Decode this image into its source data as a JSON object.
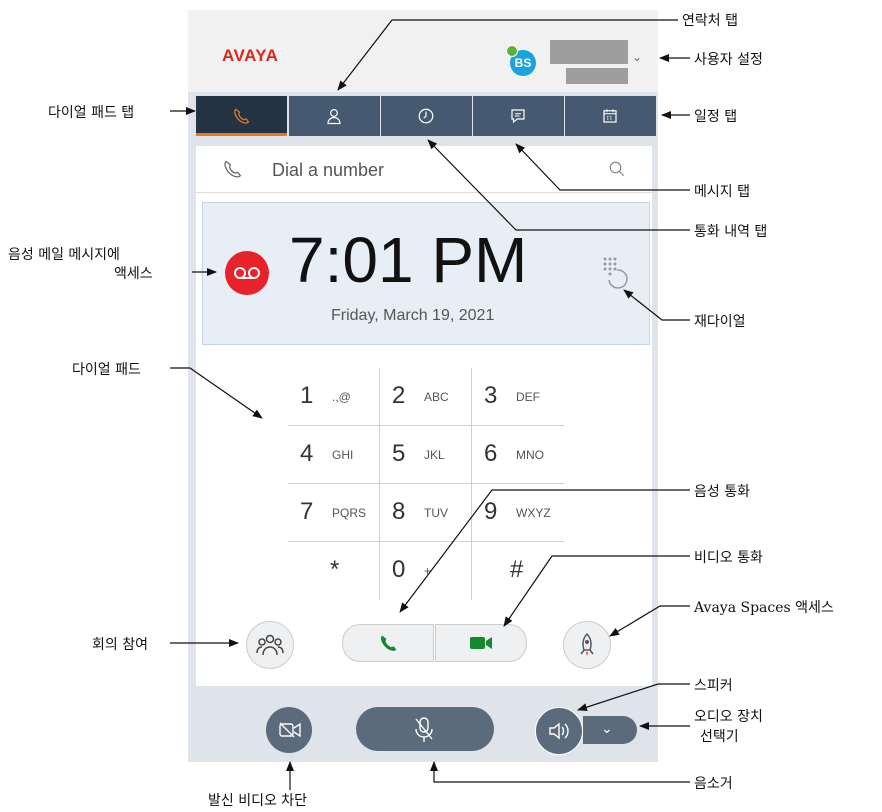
{
  "header": {
    "logo_text": "AVAYA",
    "avatar_initials": "BS"
  },
  "tabs": [
    {
      "id": "dialpad",
      "icon": "phone-icon",
      "active": true
    },
    {
      "id": "contacts",
      "icon": "person-icon",
      "active": false
    },
    {
      "id": "history",
      "icon": "clock-icon",
      "active": false
    },
    {
      "id": "messages",
      "icon": "chat-icon",
      "active": false
    },
    {
      "id": "calendar",
      "icon": "calendar-icon",
      "active": false
    }
  ],
  "search": {
    "placeholder": "Dial a number"
  },
  "clock": {
    "time": "7:01 PM",
    "date": "Friday, March 19, 2021"
  },
  "dialpad": {
    "keys": [
      {
        "num": "1",
        "letters": ".,@"
      },
      {
        "num": "2",
        "letters": "ABC"
      },
      {
        "num": "3",
        "letters": "DEF"
      },
      {
        "num": "4",
        "letters": "GHI"
      },
      {
        "num": "5",
        "letters": "JKL"
      },
      {
        "num": "6",
        "letters": "MNO"
      },
      {
        "num": "7",
        "letters": "PQRS"
      },
      {
        "num": "8",
        "letters": "TUV"
      },
      {
        "num": "9",
        "letters": "WXYZ"
      },
      {
        "num": "*",
        "letters": ""
      },
      {
        "num": "0",
        "letters": "+"
      },
      {
        "num": "#",
        "letters": ""
      }
    ]
  },
  "colors": {
    "accent": "#e87722",
    "brand": "#da291c",
    "tab_bg": "#455a70",
    "tab_active_bg": "#243444",
    "call_green": "#138a2e",
    "voicemail_red": "#e8222a"
  },
  "callouts": {
    "contacts_tab": "연락처 탭",
    "user_settings": "사용자 설정",
    "dialpad_tab": "다이얼 패드 탭",
    "calendar_tab": "일정 탭",
    "messages_tab": "메시지 탭",
    "history_tab": "통화 내역 탭",
    "voicemail_line1": "음성 메일 메시지에",
    "voicemail_line2": "액세스",
    "redial": "재다이얼",
    "dialpad": "다이얼 패드",
    "voice_call": "음성 통화",
    "video_call": "비디오 통화",
    "avaya_spaces": "Avaya Spaces 액세스",
    "join_meeting": "회의 참여",
    "speaker": "스피커",
    "audio_device_line1": "오디오 장치",
    "audio_device_line2": "선택기",
    "block_video": "발신 비디오 차단",
    "mute": "음소거"
  }
}
